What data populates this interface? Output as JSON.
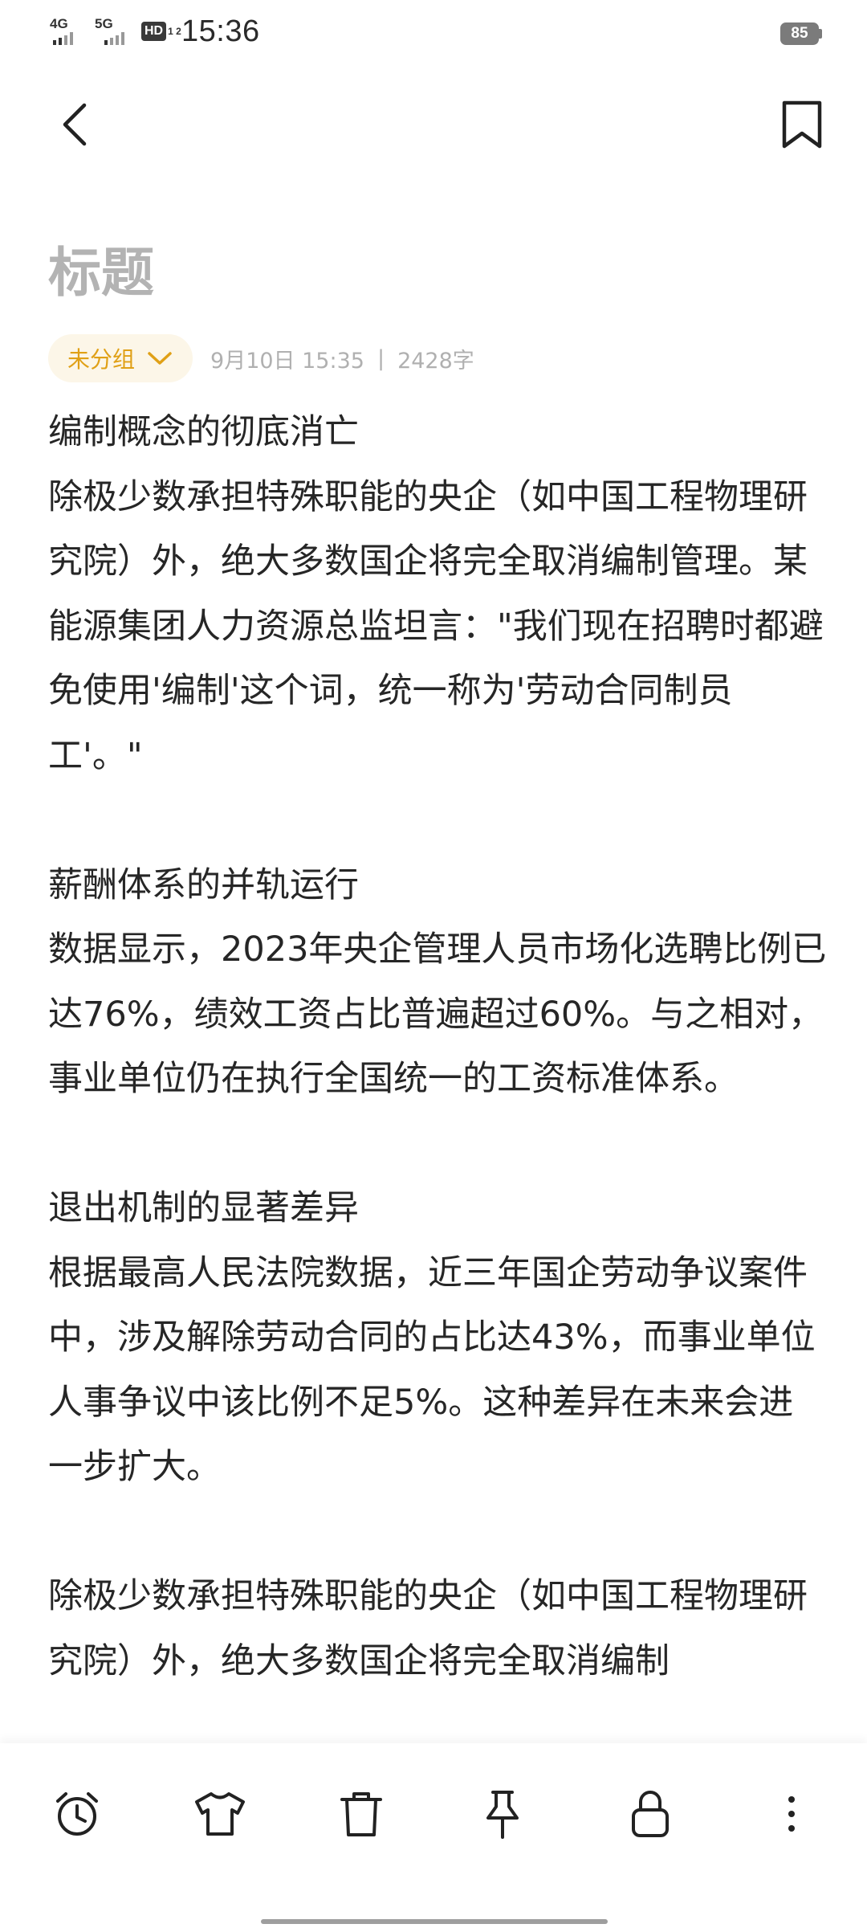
{
  "status_bar": {
    "network_1": "4G",
    "network_2": "5G",
    "hd_label": "HD",
    "hd_sub": "1 2",
    "time": "15:36",
    "battery": "85"
  },
  "header": {
    "back_icon": "back-arrow-icon",
    "bookmark_icon": "bookmark-icon"
  },
  "note": {
    "title": "标题",
    "group_label": "未分组",
    "date": "9月10日 15:35",
    "separator": "|",
    "word_count": "2428字",
    "paragraphs": [
      "编制概念的彻底消亡\n除极少数承担特殊职能的央企（如中国工程物理研究院）外，绝大多数国企将完全取消编制管理。某能源集团人力资源总监坦言：\"我们现在招聘时都避免使用'编制'这个词，统一称为'劳动合同制员工'。\"",
      "薪酬体系的并轨运行\n数据显示，2023年央企管理人员市场化选聘比例已达76%，绩效工资占比普遍超过60%。与之相对，事业单位仍在执行全国统一的工资标准体系。",
      "退出机制的显著差异\n根据最高人民法院数据，近三年国企劳动争议案件中，涉及解除劳动合同的占比达43%，而事业单位人事争议中该比例不足5%。这种差异在未来会进一步扩大。",
      "除极少数承担特殊职能的央企（如中国工程物理研究院）外，绝大多数国企将完全取消编制"
    ]
  },
  "toolbar": {
    "items": [
      {
        "icon": "alarm-clock-icon"
      },
      {
        "icon": "tshirt-icon"
      },
      {
        "icon": "trash-icon"
      },
      {
        "icon": "pin-icon"
      },
      {
        "icon": "lock-icon"
      },
      {
        "icon": "more-vertical-icon"
      }
    ]
  },
  "colors": {
    "accent": "#e0a016",
    "pill_bg": "#fcf6e8",
    "title_gray": "#b3b3b3",
    "meta_gray": "#b0b0b0",
    "body_text": "#262626"
  }
}
